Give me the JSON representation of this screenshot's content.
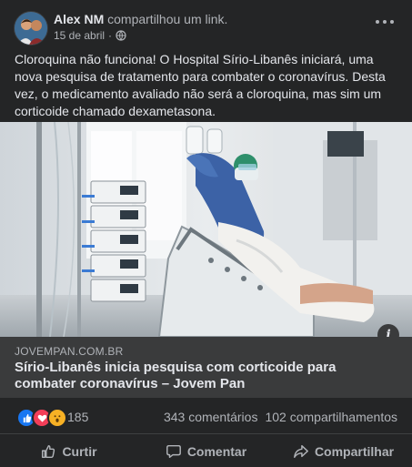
{
  "post": {
    "author": "Alex NM",
    "action_text": "compartilhou um link.",
    "date": "15 de abril",
    "separator": "·",
    "privacy_icon": "globe-icon",
    "text": "Cloroquina não funciona!   O Hospital Sírio-Libanês iniciará, uma nova pesquisa de tratamento para combater o coronavírus. Desta vez, o medicamento avaliado não será a cloroquina, mas sim um corticoide chamado dexametasona."
  },
  "link": {
    "domain": "JOVEMPAN.COM.BR",
    "title": "Sírio-Libanês inicia pesquisa com corticoide para combater coronavírus – Jovem Pan",
    "image": "hospital-icu-photo"
  },
  "reactions": {
    "types": [
      "like",
      "love",
      "wow"
    ],
    "count": "185",
    "comments": "343 comentários",
    "shares": "102 compartilhamentos"
  },
  "actions": {
    "like": "Curtir",
    "comment": "Comentar",
    "share": "Compartilhar"
  },
  "colors": {
    "background": "#242526",
    "text": "#e4e6eb",
    "secondary": "#b0b3b8",
    "link_meta_bg": "#3a3b3c",
    "like": "#1877f2",
    "love": "#f33e58",
    "wow": "#f7b125"
  }
}
